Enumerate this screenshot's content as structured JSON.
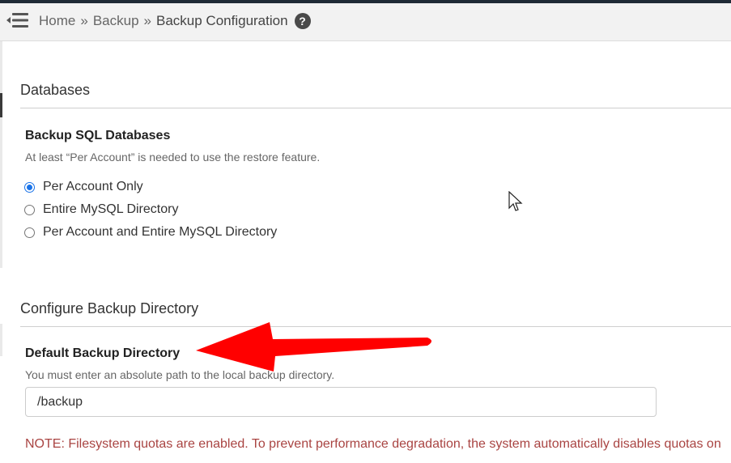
{
  "header": {
    "breadcrumb": {
      "home": "Home",
      "sep1": "»",
      "backup": "Backup",
      "sep2": "»",
      "current": "Backup Configuration"
    },
    "help_glyph": "?"
  },
  "databases": {
    "title": "Databases",
    "label": "Backup SQL Databases",
    "help": "At least “Per Account” is needed to use the restore feature.",
    "options": [
      {
        "label": "Per Account Only",
        "checked": true
      },
      {
        "label": "Entire MySQL Directory",
        "checked": false
      },
      {
        "label": "Per Account and Entire MySQL Directory",
        "checked": false
      }
    ]
  },
  "backup_directory": {
    "title": "Configure Backup Directory",
    "label": "Default Backup Directory",
    "help": "You must enter an absolute path to the local backup directory.",
    "value": "/backup",
    "note": "NOTE: Filesystem quotas are enabled. To prevent performance degradation, the system automatically disables quotas on"
  },
  "colors": {
    "accent": "#1a73e8",
    "note": "#a94442",
    "arrow": "#ff0000"
  },
  "icons": {
    "menu": "menu-toggle-icon",
    "help": "help-icon",
    "cursor": "mouse-cursor-icon",
    "annotation": "red-arrow-annotation"
  }
}
